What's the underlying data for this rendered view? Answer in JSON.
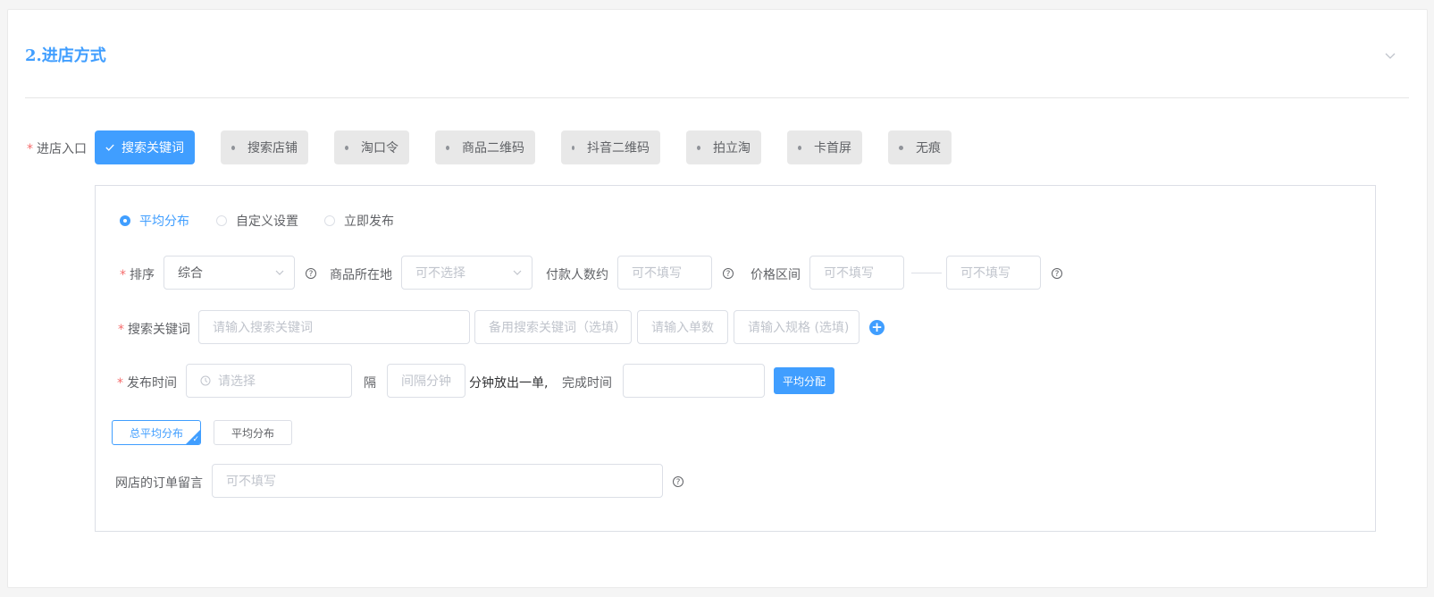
{
  "section": {
    "title": "2.进店方式"
  },
  "entry": {
    "label": "进店入口",
    "options": [
      {
        "label": "搜索关键词",
        "selected": true
      },
      {
        "label": "搜索店铺",
        "selected": false
      },
      {
        "label": "淘口令",
        "selected": false
      },
      {
        "label": "商品二维码",
        "selected": false
      },
      {
        "label": "抖音二维码",
        "selected": false
      },
      {
        "label": "拍立淘",
        "selected": false
      },
      {
        "label": "卡首屏",
        "selected": false
      },
      {
        "label": "无痕",
        "selected": false
      }
    ]
  },
  "distribution": {
    "options": [
      {
        "label": "平均分布",
        "checked": true
      },
      {
        "label": "自定义设置",
        "checked": false
      },
      {
        "label": "立即发布",
        "checked": false
      }
    ]
  },
  "sort": {
    "label": "排序",
    "value": "综合"
  },
  "location": {
    "label": "商品所在地",
    "placeholder": "可不选择"
  },
  "payers": {
    "label": "付款人数约",
    "placeholder": "可不填写"
  },
  "price": {
    "label": "价格区间",
    "min_placeholder": "可不填写",
    "max_placeholder": "可不填写"
  },
  "keyword": {
    "label": "搜索关键词",
    "main_placeholder": "请输入搜索关键词",
    "backup_placeholder": "备用搜索关键词（选填）",
    "count_placeholder": "请输入单数",
    "spec_placeholder": "请输入规格 (选填)",
    "add_icon": "plus-circle-icon"
  },
  "publish": {
    "label": "发布时间",
    "time_placeholder": "请选择",
    "interval_prefix": "隔",
    "interval_placeholder": "间隔分钟",
    "interval_suffix": "分钟放出一单,",
    "finish_label": "完成时间",
    "finish_value": "",
    "average_button": "平均分配"
  },
  "modes": {
    "total_average": "总平均分布",
    "average": "平均分布"
  },
  "note": {
    "label": "网店的订单留言",
    "placeholder": "可不填写"
  },
  "colors": {
    "primary": "#409eff",
    "required": "#f56c6c",
    "border": "#dcdfe6"
  }
}
